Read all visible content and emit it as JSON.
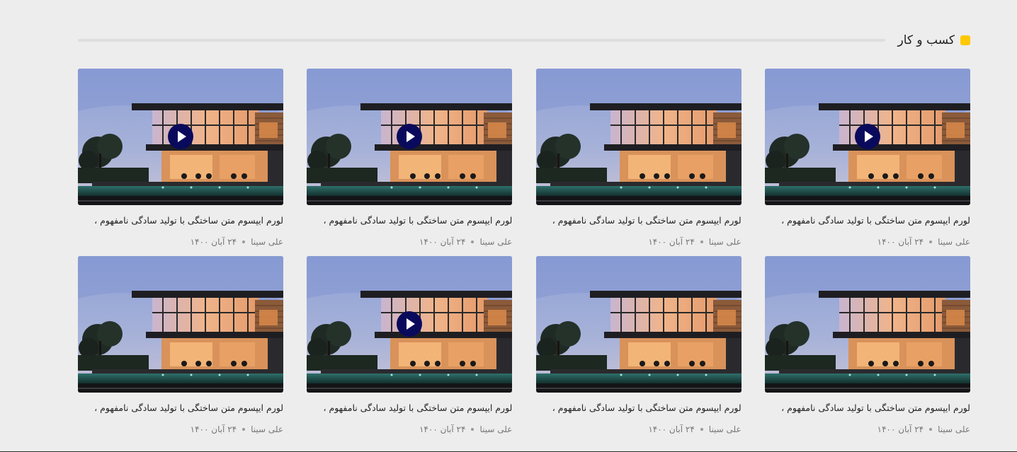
{
  "section": {
    "title": "کسب و کار",
    "accent_color": "#ffc800"
  },
  "cards": [
    {
      "title": "لورم ایپسوم متن ساختگی با تولید سادگی نامفهوم ،",
      "author": "علی سینا",
      "date": "۲۴ آبان ۱۴۰۰",
      "has_video": true
    },
    {
      "title": "لورم ایپسوم متن ساختگی با تولید سادگی نامفهوم ،",
      "author": "علی سینا",
      "date": "۲۴ آبان ۱۴۰۰",
      "has_video": false
    },
    {
      "title": "لورم ایپسوم متن ساختگی با تولید سادگی نامفهوم ،",
      "author": "علی سینا",
      "date": "۲۴ آبان ۱۴۰۰",
      "has_video": true
    },
    {
      "title": "لورم ایپسوم متن ساختگی با تولید سادگی نامفهوم ،",
      "author": "علی سینا",
      "date": "۲۴ آبان ۱۴۰۰",
      "has_video": true
    },
    {
      "title": "لورم ایپسوم متن ساختگی با تولید سادگی نامفهوم ،",
      "author": "علی سینا",
      "date": "۲۴ آبان ۱۴۰۰",
      "has_video": false
    },
    {
      "title": "لورم ایپسوم متن ساختگی با تولید سادگی نامفهوم ،",
      "author": "علی سینا",
      "date": "۲۴ آبان ۱۴۰۰",
      "has_video": false
    },
    {
      "title": "لورم ایپسوم متن ساختگی با تولید سادگی نامفهوم ،",
      "author": "علی سینا",
      "date": "۲۴ آبان ۱۴۰۰",
      "has_video": true
    },
    {
      "title": "لورم ایپسوم متن ساختگی با تولید سادگی نامفهوم ،",
      "author": "علی سینا",
      "date": "۲۴ آبان ۱۴۰۰",
      "has_video": false
    }
  ],
  "icons": {
    "play": "play-icon",
    "thumbnail": "modern-house-image"
  }
}
